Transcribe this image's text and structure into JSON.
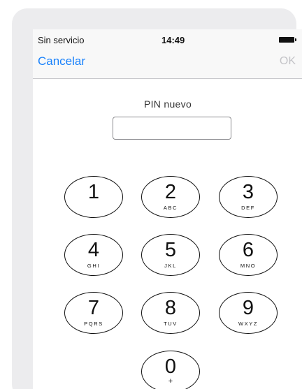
{
  "status_bar": {
    "carrier": "Sin servicio",
    "time": "14:49",
    "battery_icon": "battery-full-icon"
  },
  "nav_bar": {
    "cancel_label": "Cancelar",
    "ok_label": "OK"
  },
  "pin": {
    "label": "PIN nuevo",
    "value": ""
  },
  "keypad": [
    {
      "digit": "1",
      "letters": ""
    },
    {
      "digit": "2",
      "letters": "ABC"
    },
    {
      "digit": "3",
      "letters": "DEF"
    },
    {
      "digit": "4",
      "letters": "GHI"
    },
    {
      "digit": "5",
      "letters": "JKL"
    },
    {
      "digit": "6",
      "letters": "MNO"
    },
    {
      "digit": "7",
      "letters": "PQRS"
    },
    {
      "digit": "8",
      "letters": "TUV"
    },
    {
      "digit": "9",
      "letters": "WXYZ"
    },
    {
      "digit": "0",
      "letters": "+"
    }
  ],
  "colors": {
    "accent": "#1a82fb",
    "disabled": "#c4c4c8",
    "frame": "#ececee"
  }
}
